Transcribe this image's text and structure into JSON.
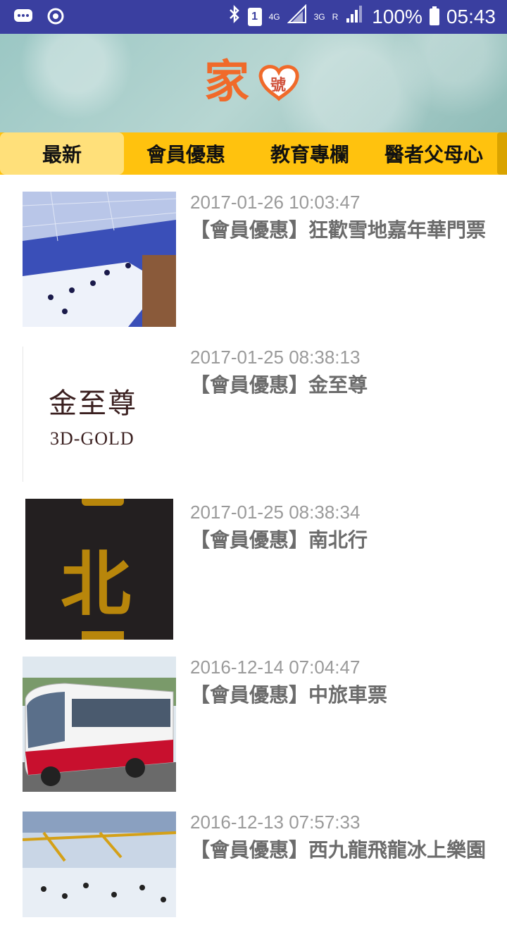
{
  "status_bar": {
    "battery": "100%",
    "time": "05:43",
    "sim_slot": "1",
    "network_4g": "4G",
    "network_3g": "3G",
    "roaming": "R",
    "icons": [
      "message-icon",
      "sync-icon",
      "bluetooth-icon",
      "sim-icon",
      "signal-icon",
      "battery-icon"
    ]
  },
  "header": {
    "logo_text_main": "家",
    "logo_text_small": "號"
  },
  "tabs": [
    {
      "label": "最新",
      "active": true
    },
    {
      "label": "會員優惠",
      "active": false
    },
    {
      "label": "教育專欄",
      "active": false
    },
    {
      "label": "醫者父母心",
      "active": false
    }
  ],
  "articles": [
    {
      "date": "2017-01-26 10:03:47",
      "title": "【會員優惠】狂歡雪地嘉年華門票",
      "thumb": "ice-park-photo"
    },
    {
      "date": "2017-01-25 08:38:13",
      "title": "【會員優惠】金至尊",
      "thumb": "3d-gold-logo",
      "thumb_text": "金至尊",
      "thumb_subtext": "3D-GOLD"
    },
    {
      "date": "2017-01-25 08:38:34",
      "title": "【會員優惠】南北行",
      "thumb": "nanbeihang-logo",
      "thumb_text": "北"
    },
    {
      "date": "2016-12-14 07:04:47",
      "title": "【會員優惠】中旅車票",
      "thumb": "bus-photo"
    },
    {
      "date": "2016-12-13 07:57:33",
      "title": "【會員優惠】西九龍飛龍冰上樂園",
      "thumb": "ice-rink-photo"
    }
  ],
  "colors": {
    "status_bar": "#3a3fa0",
    "tab_bar": "#ffc20e",
    "tab_active": "#ffe07a",
    "date_text": "#9a9a9a",
    "title_text": "#6b6b6b"
  }
}
